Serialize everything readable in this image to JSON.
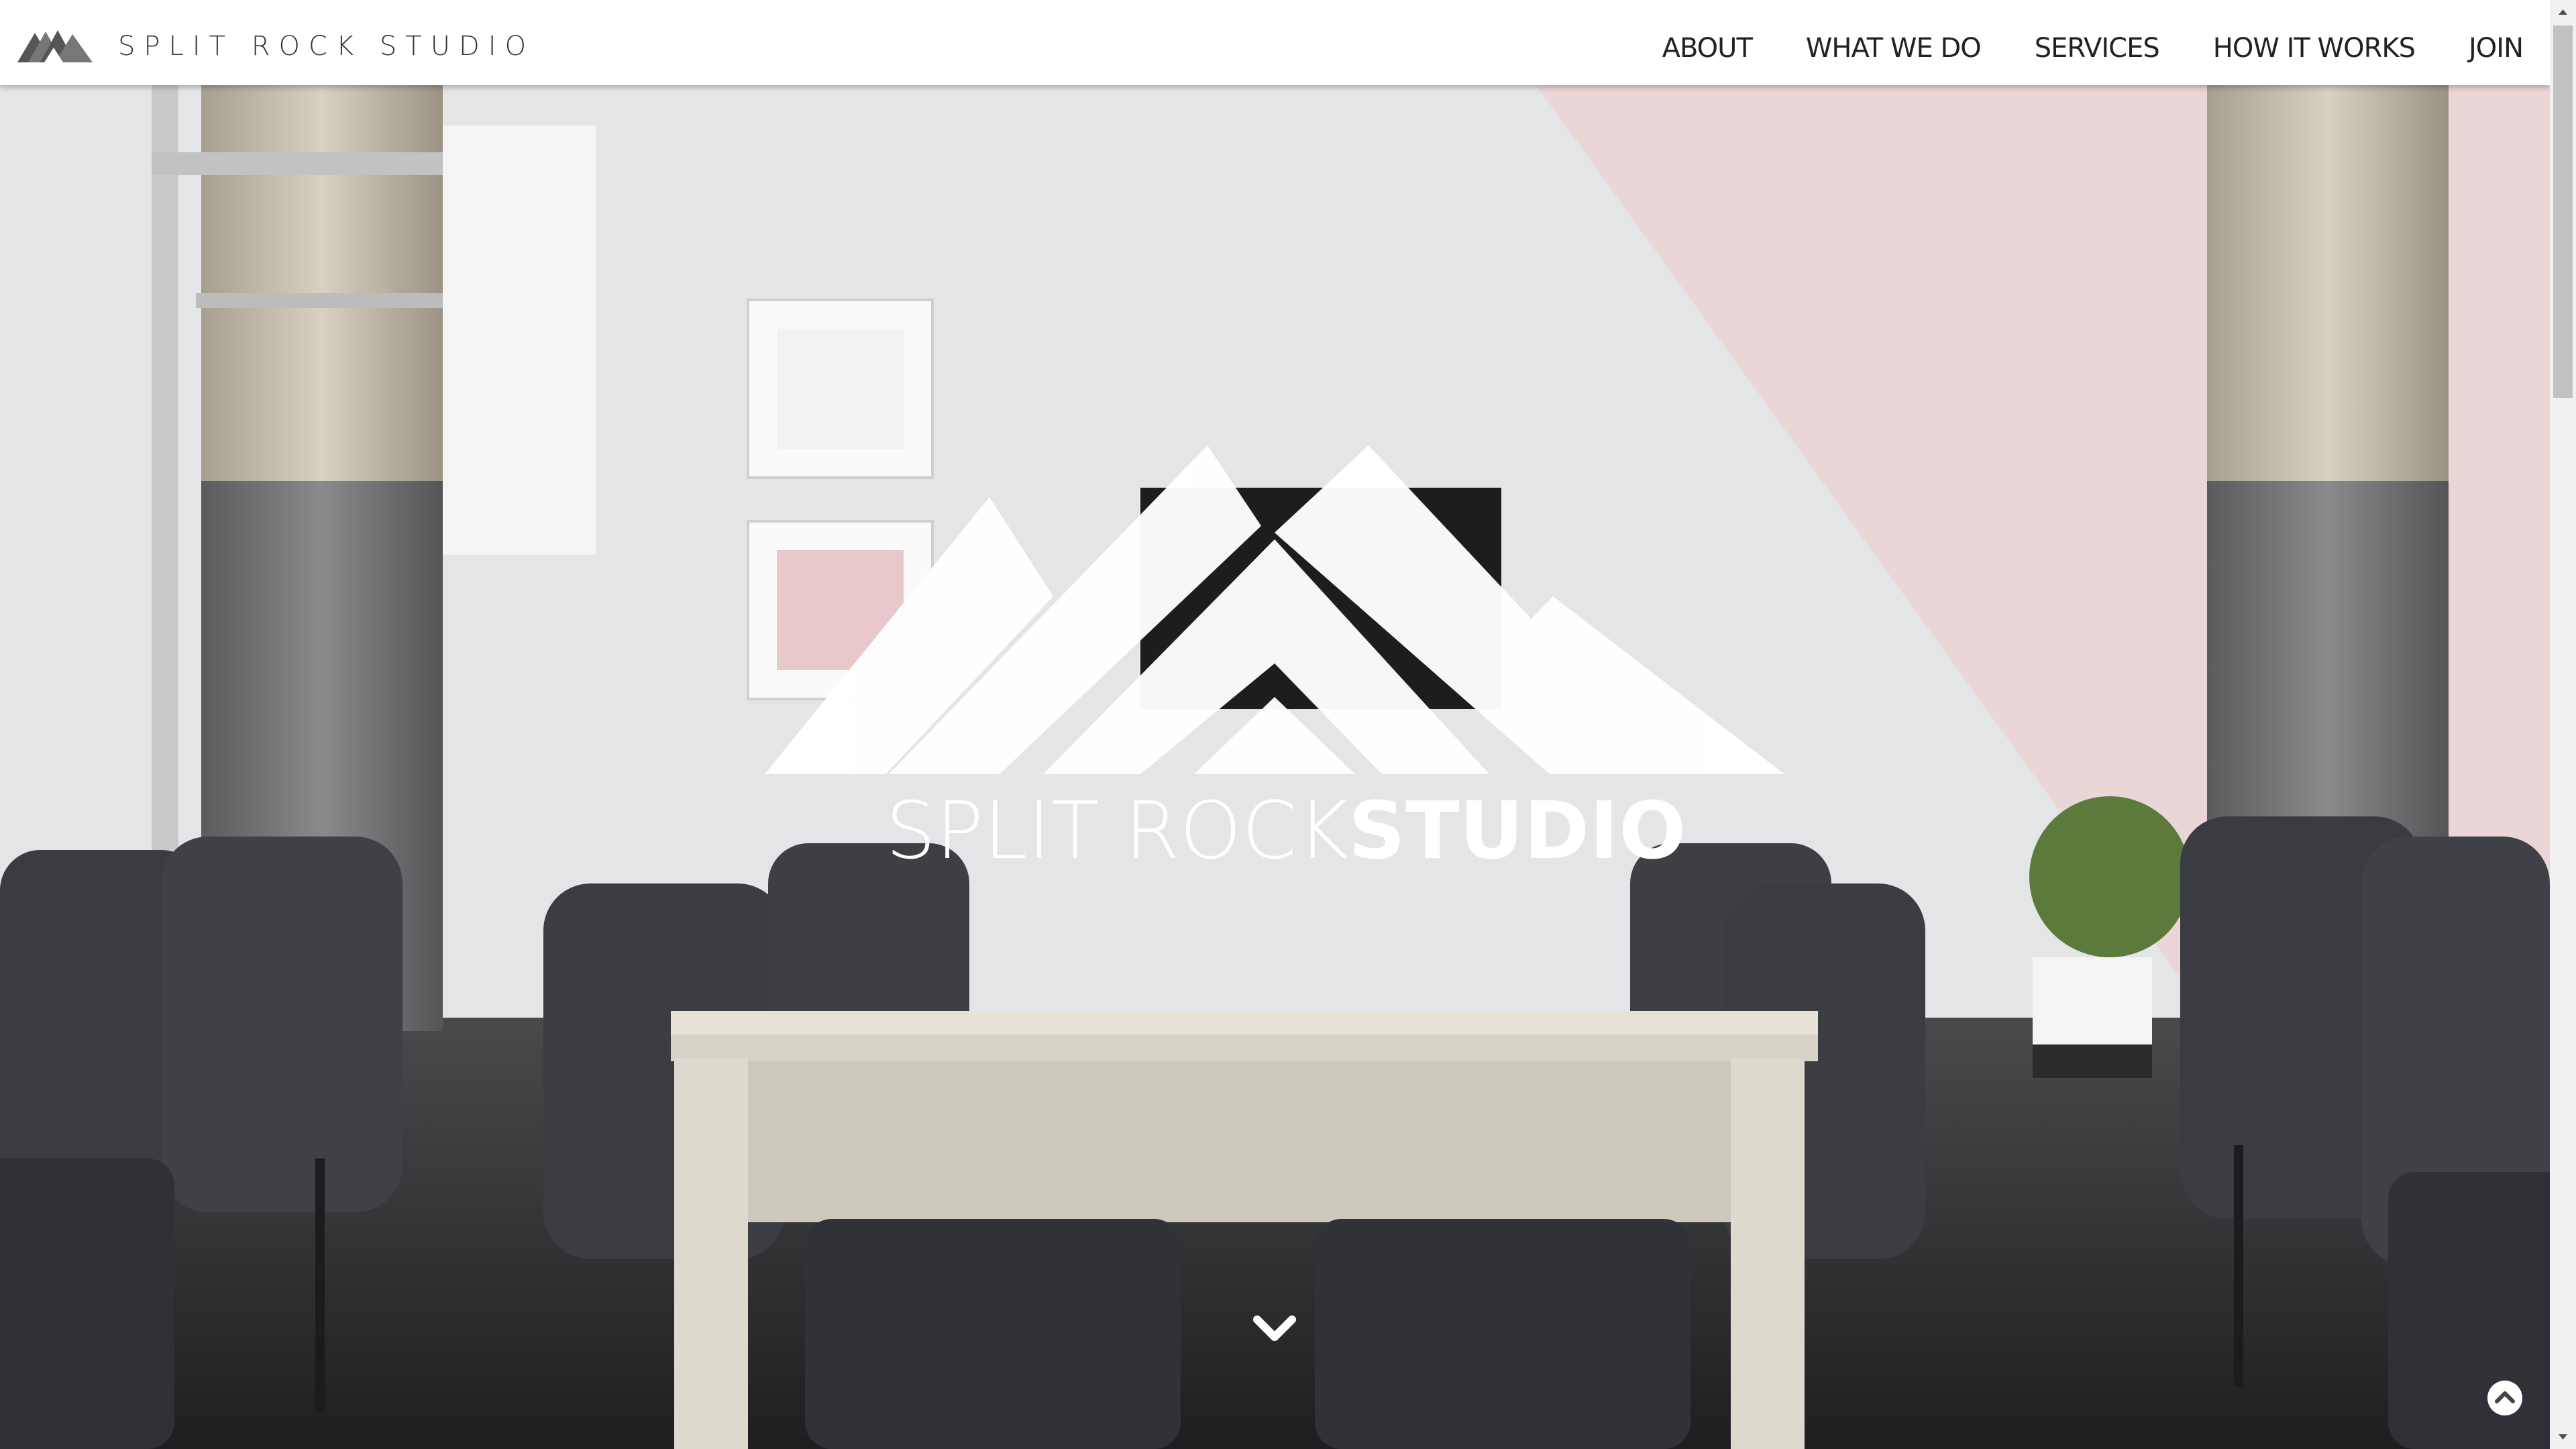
{
  "nav": {
    "brand": "SPLIT ROCK STUDIO",
    "logo_icon": "mountain-logo-icon",
    "items": [
      {
        "label": "ABOUT"
      },
      {
        "label": "WHAT WE DO"
      },
      {
        "label": "SERVICES"
      },
      {
        "label": "HOW IT WORKS"
      },
      {
        "label": "JOIN"
      }
    ]
  },
  "hero": {
    "logo_text_light": "SPLIT ROCK",
    "logo_text_bold": "STUDIO",
    "scroll_icon": "chevron-down-icon",
    "top_icon": "chevron-up-circle-icon"
  },
  "colors": {
    "wall": "#e6e7e9",
    "pink_wall": "#ecd8da",
    "floor": "#2a2a2c",
    "chair": "#3a3c42",
    "table": "#dedbd3"
  }
}
